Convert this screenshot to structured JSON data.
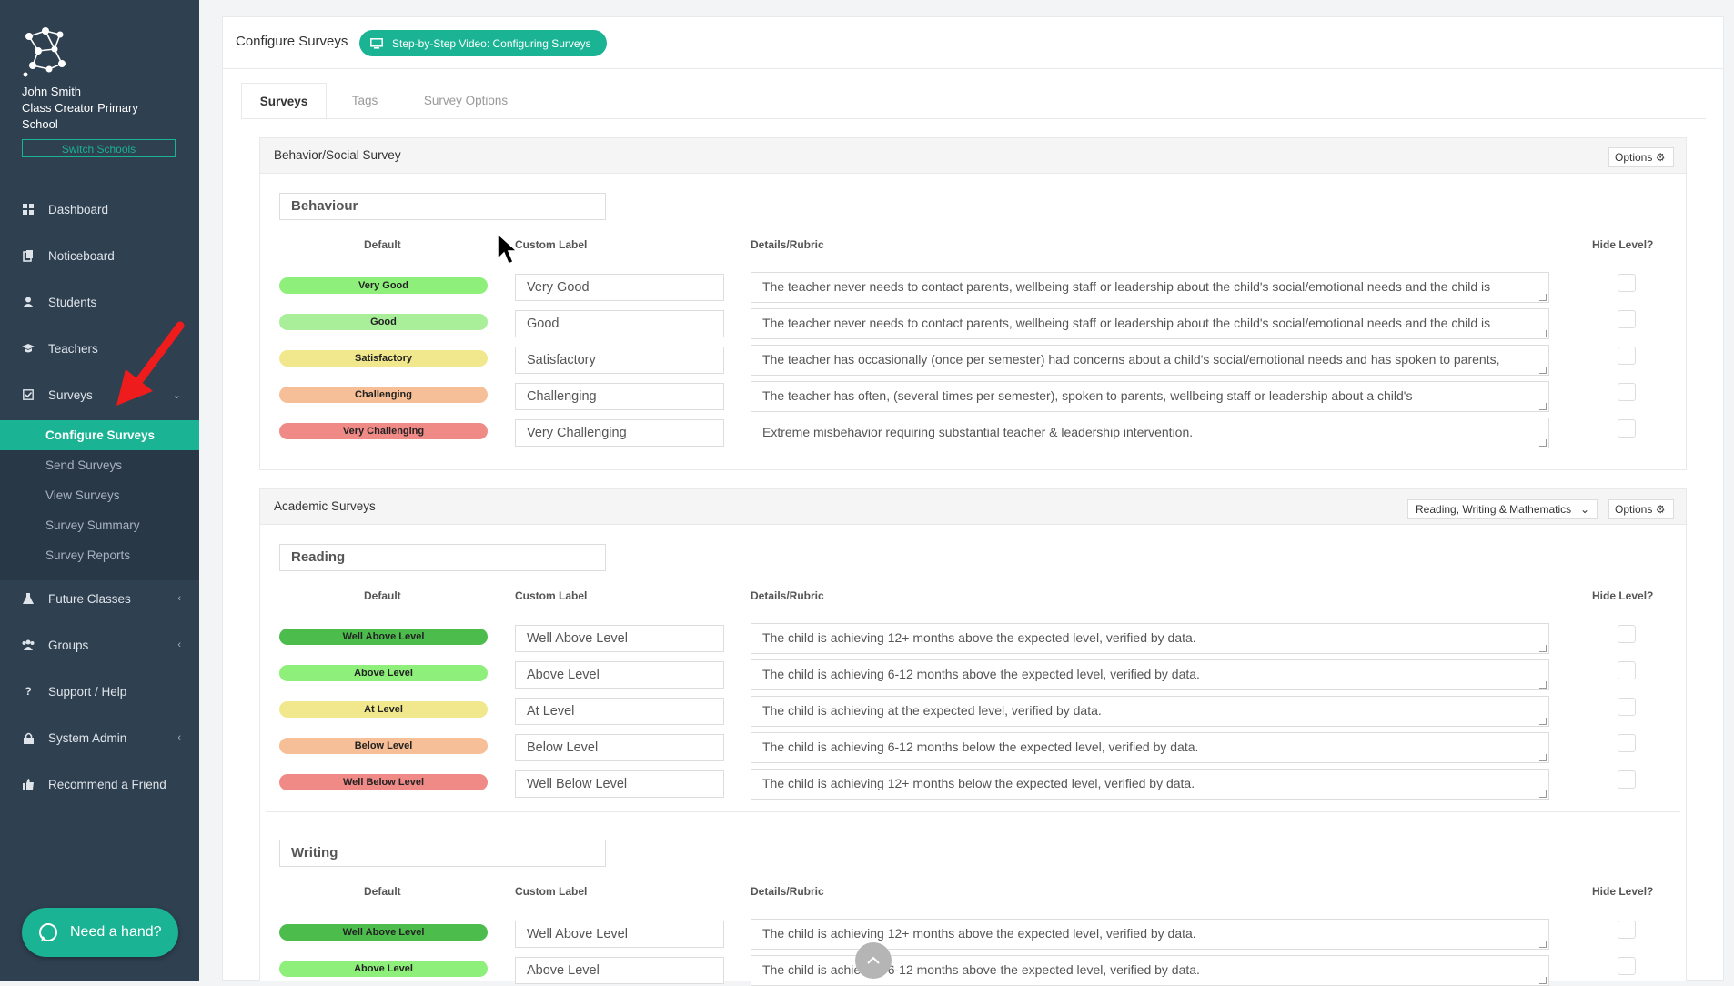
{
  "user": {
    "name": "John Smith",
    "school": "Class Creator Primary School",
    "switch_label": "Switch Schools"
  },
  "nav": {
    "dashboard": "Dashboard",
    "noticeboard": "Noticeboard",
    "students": "Students",
    "teachers": "Teachers",
    "surveys": "Surveys",
    "future_classes": "Future Classes",
    "groups": "Groups",
    "support": "Support / Help",
    "system_admin": "System Admin",
    "recommend": "Recommend a Friend"
  },
  "surveys_sub": [
    "Configure Surveys",
    "Send Surveys",
    "View Surveys",
    "Survey Summary",
    "Survey Reports"
  ],
  "help_label": "Need a hand?",
  "header": {
    "title": "Configure Surveys",
    "video_label": "Step-by-Step Video: Configuring Surveys"
  },
  "tabs": [
    "Surveys",
    "Tags",
    "Survey Options"
  ],
  "options_label": "Options",
  "columns": {
    "default": "Default",
    "custom": "Custom Label",
    "details": "Details/Rubric",
    "hide": "Hide Level?"
  },
  "behavior": {
    "panel_title": "Behavior/Social Survey",
    "section_title": "Behaviour",
    "rows": [
      {
        "default": "Very Good",
        "label": "Very Good",
        "detail": "The teacher never needs to contact parents, wellbeing staff or leadership about the child's social/emotional needs and the child is"
      },
      {
        "default": "Good",
        "label": "Good",
        "detail": "The teacher never needs to contact parents, wellbeing staff or leadership about the child's social/emotional needs and the child is"
      },
      {
        "default": "Satisfactory",
        "label": "Satisfactory",
        "detail": "The teacher has occasionally (once per semester) had concerns about a child's social/emotional needs and has spoken to parents,"
      },
      {
        "default": "Challenging",
        "label": "Challenging",
        "detail": "The teacher has often, (several times per semester), spoken to parents, wellbeing staff or leadership about a child's"
      },
      {
        "default": "Very Challenging",
        "label": "Very Challenging",
        "detail": "Extreme misbehavior requiring substantial teacher & leadership intervention."
      }
    ]
  },
  "academic": {
    "panel_title": "Academic Surveys",
    "select_value": "Reading, Writing & Mathematics",
    "reading_title": "Reading",
    "writing_title": "Writing",
    "rows": [
      {
        "default": "Well Above Level",
        "label": "Well Above Level",
        "detail": "The child is achieving 12+ months above the expected level, verified by data."
      },
      {
        "default": "Above Level",
        "label": "Above Level",
        "detail": "The child is achieving 6-12 months above the expected level, verified by data."
      },
      {
        "default": "At Level",
        "label": "At Level",
        "detail": "The child is achieving at the expected level, verified by data."
      },
      {
        "default": "Below Level",
        "label": "Below Level",
        "detail": "The child is achieving 6-12 months below the expected level, verified by data."
      },
      {
        "default": "Well Below Level",
        "label": "Well Below Level",
        "detail": "The child is achieving 12+ months below the expected level, verified by data."
      }
    ]
  },
  "colors": {
    "sidebar": "#2f4050",
    "accent": "#1ab394",
    "pill_dark_green": "#4cbc4c",
    "pill_green": "#8ef07a",
    "pill_light_green": "#a9ef9a",
    "pill_yellow": "#f1e78c",
    "pill_orange": "#f6bf97",
    "pill_red": "#f08a87"
  }
}
